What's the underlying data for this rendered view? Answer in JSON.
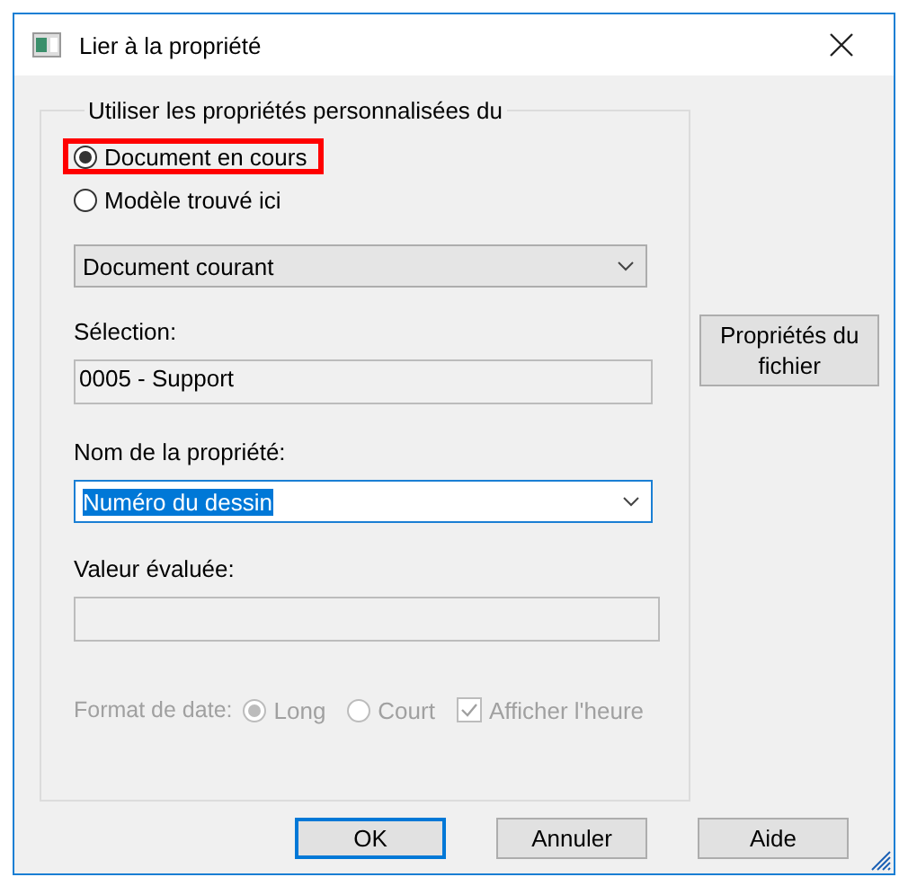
{
  "window": {
    "title": "Lier à la propriété"
  },
  "group": {
    "legend": "Utiliser les propriétés personnalisées du",
    "sources": [
      {
        "label": "Document en cours",
        "selected": true,
        "highlighted": true
      },
      {
        "label": "Modèle trouvé ici",
        "selected": false,
        "highlighted": false
      }
    ],
    "source_dropdown": {
      "value": "Document courant"
    },
    "selection": {
      "label": "Sélection:",
      "value": "0005 - Support"
    },
    "property_name": {
      "label": "Nom de la propriété:",
      "value": "Numéro du dessin",
      "text_selected": true,
      "focused": true
    },
    "evaluated_value": {
      "label": "Valeur évaluée:"
    },
    "date_format": {
      "label": "Format de date:",
      "disabled": true,
      "options": [
        {
          "label": "Long",
          "selected": true
        },
        {
          "label": "Court",
          "selected": false
        }
      ],
      "show_time": {
        "label": "Afficher l'heure",
        "checked": true
      }
    }
  },
  "file_properties_button": "Propriétés du fichier",
  "buttons": [
    {
      "label": "OK",
      "default": true
    },
    {
      "label": "Annuler",
      "default": false
    },
    {
      "label": "Aide",
      "default": false
    }
  ]
}
